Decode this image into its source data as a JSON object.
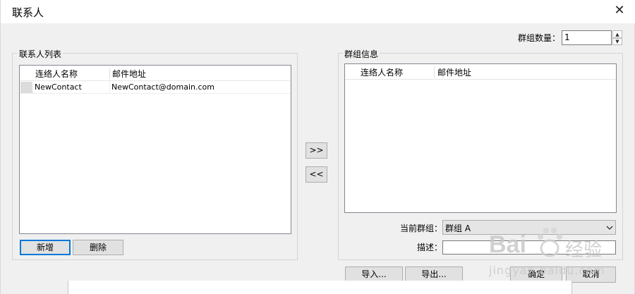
{
  "window": {
    "title": "联系人",
    "close_glyph": "✕"
  },
  "group_count": {
    "label": "群组数量：",
    "value": "1",
    "up": "▲",
    "down": "▼"
  },
  "contacts": {
    "legend": "联系人列表",
    "columns": [
      "连络人名称",
      "邮件地址"
    ],
    "rows": [
      {
        "name": "NewContact",
        "email": "NewContact@domain.com"
      }
    ],
    "add_label": "新增",
    "delete_label": "删除"
  },
  "move": {
    "add_label": ">>",
    "remove_label": "<<"
  },
  "group_info": {
    "legend": "群组信息",
    "columns": [
      "连络人名称",
      "邮件地址"
    ],
    "current_label": "当前群组：",
    "current_value": "群组 A",
    "desc_label": "描述：",
    "desc_value": ""
  },
  "footer": {
    "import_label": "导入...",
    "export_label": "导出...",
    "ok_label": "确定",
    "cancel_label": "取消"
  },
  "watermark": {
    "brand": "Bai",
    "brand_suffix": "经验",
    "url": "jingyan.baidu.com"
  },
  "colors": {
    "accent": "#0078d7",
    "window_bg": "#f0f0f0",
    "button_bg": "#e1e1e1"
  }
}
